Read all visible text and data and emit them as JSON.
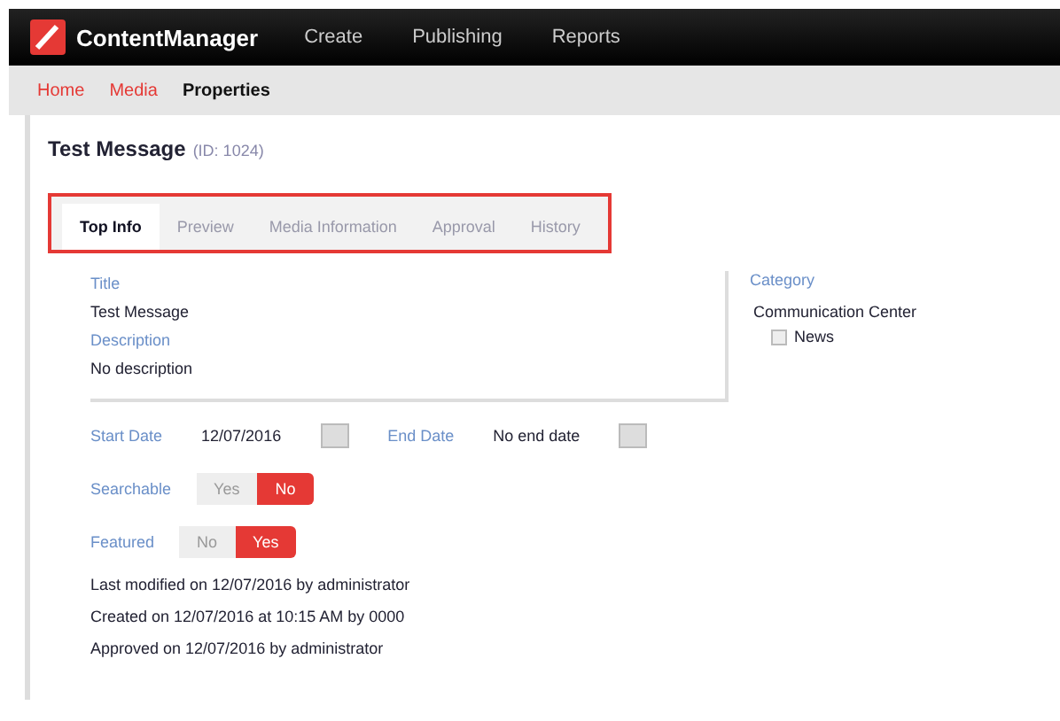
{
  "header": {
    "logo": "ContentManager",
    "nav": [
      "Create",
      "Publishing",
      "Reports"
    ]
  },
  "breadcrumb": [
    {
      "label": "Home",
      "current": false
    },
    {
      "label": "Media",
      "current": false
    },
    {
      "label": "Properties",
      "current": true
    }
  ],
  "page": {
    "title": "Test Message",
    "subtitle": "(ID: 1024)"
  },
  "tabs": [
    {
      "label": "Top Info",
      "selected": true
    },
    {
      "label": "Preview",
      "selected": false
    },
    {
      "label": "Media Information",
      "selected": false
    },
    {
      "label": "Approval",
      "selected": false
    },
    {
      "label": "History",
      "selected": false
    }
  ],
  "fields": [
    {
      "label": "Title",
      "value": "Test Message"
    },
    {
      "label": "Description",
      "value": "No description"
    }
  ],
  "dates": [
    {
      "label": "Start Date",
      "value": "12/07/2016"
    },
    {
      "label": "End Date",
      "value": "No end date"
    }
  ],
  "toggles": [
    {
      "label": "Searchable",
      "options": [
        {
          "label": "Yes",
          "selected": false
        },
        {
          "label": "No",
          "selected": true
        }
      ]
    },
    {
      "label": "Featured",
      "options": [
        {
          "label": "No",
          "selected": false
        },
        {
          "label": "Yes",
          "selected": true
        }
      ]
    }
  ],
  "info_lines": [
    "Last modified on 12/07/2016 by administrator",
    "Created on 12/07/2016 at 10:15 AM by 0000",
    "Approved on 12/07/2016 by administrator"
  ],
  "category": {
    "label": "Category",
    "tree": [
      {
        "label": "Communication Center",
        "children": [
          {
            "label": "News",
            "checked": false
          }
        ]
      }
    ]
  }
}
